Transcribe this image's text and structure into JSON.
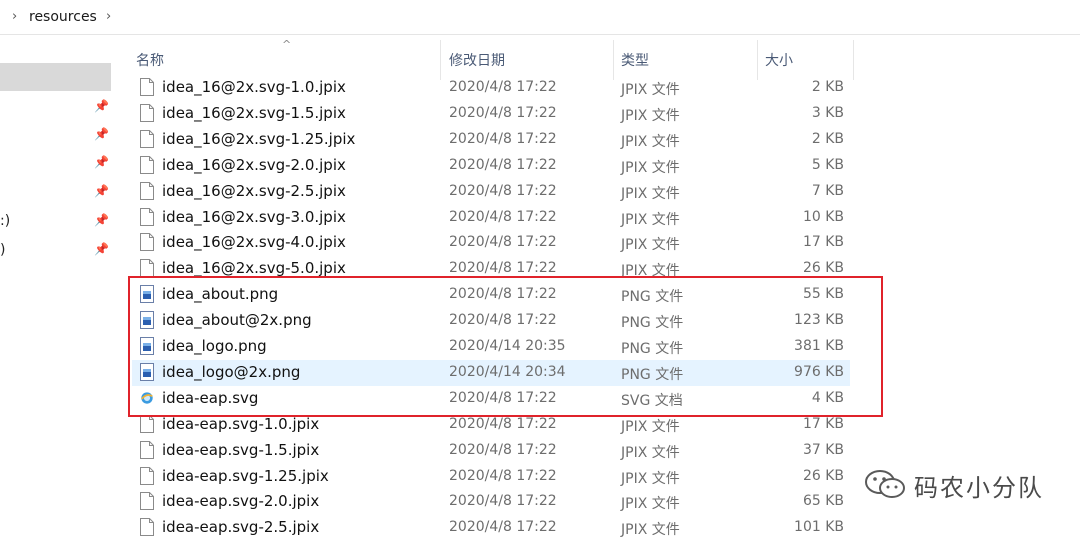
{
  "address_bar": {
    "crumb": "resources"
  },
  "nav_pane": {
    "fragments": [
      ":)",
      ")"
    ]
  },
  "columns": {
    "name": "名称",
    "date": "修改日期",
    "type": "类型",
    "size": "大小"
  },
  "files": [
    {
      "name": "idea_16@2x.svg-1.0.jpix",
      "date": "2020/4/8 17:22",
      "type": "JPIX 文件",
      "size": "2 KB",
      "icon": "generic-file-icon"
    },
    {
      "name": "idea_16@2x.svg-1.5.jpix",
      "date": "2020/4/8 17:22",
      "type": "JPIX 文件",
      "size": "3 KB",
      "icon": "generic-file-icon"
    },
    {
      "name": "idea_16@2x.svg-1.25.jpix",
      "date": "2020/4/8 17:22",
      "type": "JPIX 文件",
      "size": "2 KB",
      "icon": "generic-file-icon"
    },
    {
      "name": "idea_16@2x.svg-2.0.jpix",
      "date": "2020/4/8 17:22",
      "type": "JPIX 文件",
      "size": "5 KB",
      "icon": "generic-file-icon"
    },
    {
      "name": "idea_16@2x.svg-2.5.jpix",
      "date": "2020/4/8 17:22",
      "type": "JPIX 文件",
      "size": "7 KB",
      "icon": "generic-file-icon"
    },
    {
      "name": "idea_16@2x.svg-3.0.jpix",
      "date": "2020/4/8 17:22",
      "type": "JPIX 文件",
      "size": "10 KB",
      "icon": "generic-file-icon"
    },
    {
      "name": "idea_16@2x.svg-4.0.jpix",
      "date": "2020/4/8 17:22",
      "type": "JPIX 文件",
      "size": "17 KB",
      "icon": "generic-file-icon"
    },
    {
      "name": "idea_16@2x.svg-5.0.jpix",
      "date": "2020/4/8 17:22",
      "type": "JPIX 文件",
      "size": "26 KB",
      "icon": "generic-file-icon"
    },
    {
      "name": "idea_about.png",
      "date": "2020/4/8 17:22",
      "type": "PNG 文件",
      "size": "55 KB",
      "icon": "image-file-icon"
    },
    {
      "name": "idea_about@2x.png",
      "date": "2020/4/8 17:22",
      "type": "PNG 文件",
      "size": "123 KB",
      "icon": "image-file-icon"
    },
    {
      "name": "idea_logo.png",
      "date": "2020/4/14 20:35",
      "type": "PNG 文件",
      "size": "381 KB",
      "icon": "image-file-icon"
    },
    {
      "name": "idea_logo@2x.png",
      "date": "2020/4/14 20:34",
      "type": "PNG 文件",
      "size": "976 KB",
      "icon": "image-file-icon",
      "selected": true
    },
    {
      "name": "idea-eap.svg",
      "date": "2020/4/8 17:22",
      "type": "SVG 文档",
      "size": "4 KB",
      "icon": "svg-browser-icon"
    },
    {
      "name": "idea-eap.svg-1.0.jpix",
      "date": "2020/4/8 17:22",
      "type": "JPIX 文件",
      "size": "17 KB",
      "icon": "generic-file-icon"
    },
    {
      "name": "idea-eap.svg-1.5.jpix",
      "date": "2020/4/8 17:22",
      "type": "JPIX 文件",
      "size": "37 KB",
      "icon": "generic-file-icon"
    },
    {
      "name": "idea-eap.svg-1.25.jpix",
      "date": "2020/4/8 17:22",
      "type": "JPIX 文件",
      "size": "26 KB",
      "icon": "generic-file-icon"
    },
    {
      "name": "idea-eap.svg-2.0.jpix",
      "date": "2020/4/8 17:22",
      "type": "JPIX 文件",
      "size": "65 KB",
      "icon": "generic-file-icon"
    },
    {
      "name": "idea-eap.svg-2.5.jpix",
      "date": "2020/4/8 17:22",
      "type": "JPIX 文件",
      "size": "101 KB",
      "icon": "generic-file-icon"
    }
  ],
  "colors": {
    "highlight_box": "#e0232b",
    "selected_row": "#e5f3ff"
  },
  "watermark": {
    "text": "码农小分队",
    "icon": "wechat-icon"
  }
}
